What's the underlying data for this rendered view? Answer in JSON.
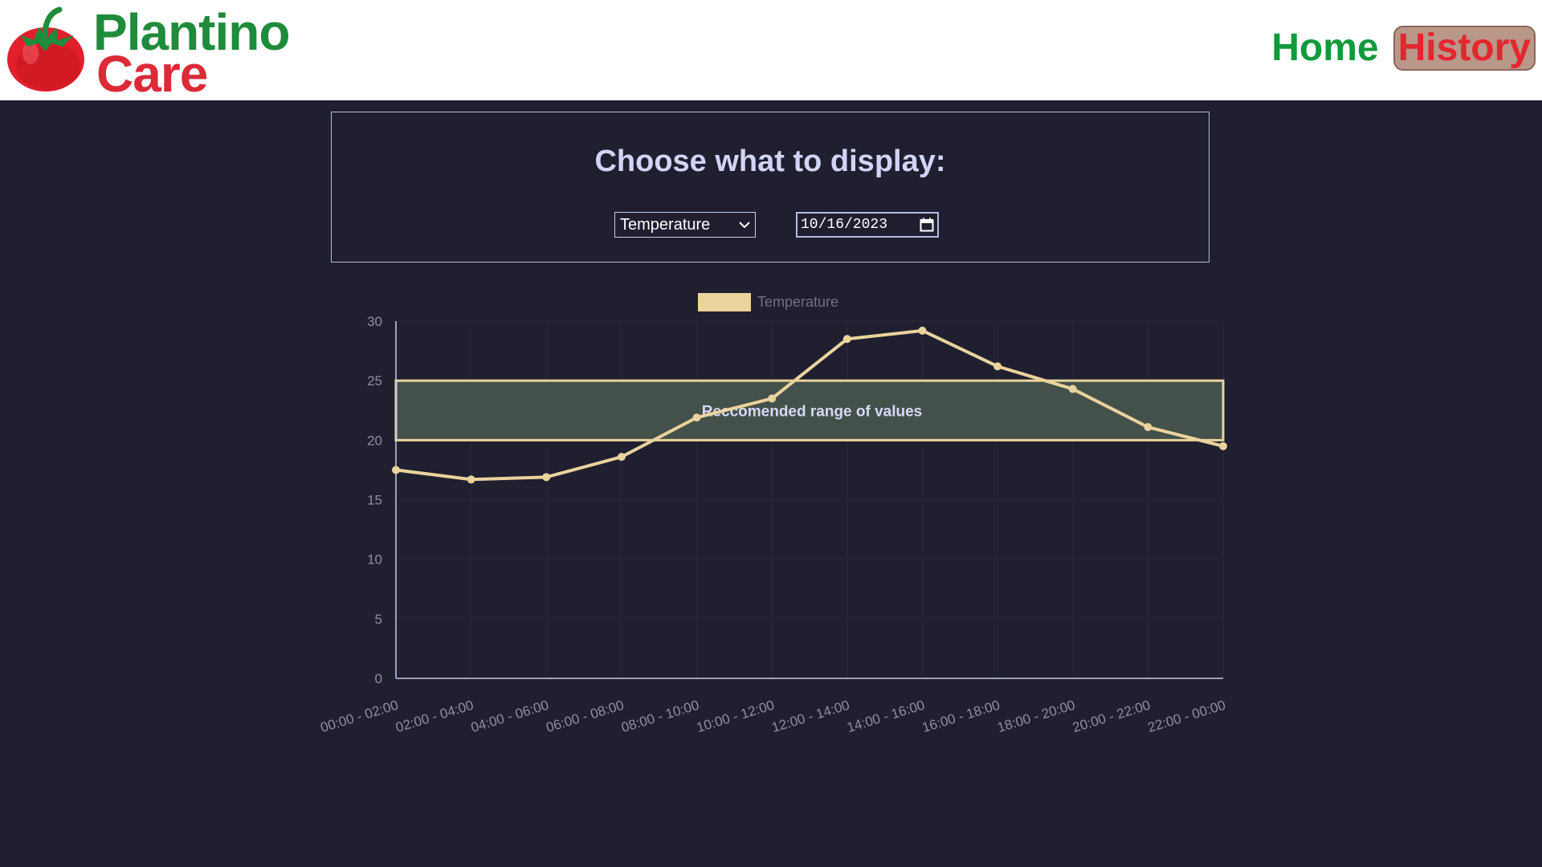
{
  "app": {
    "brand_line1": "Plantino",
    "brand_line2": "Care",
    "brand_colors": {
      "green": "#1f8b3c",
      "red": "#dc2a37"
    }
  },
  "nav": {
    "home_label": "Home",
    "history_label": "History",
    "active": "History"
  },
  "chooser": {
    "title": "Choose what to display:",
    "metric_select": {
      "value": "Temperature"
    },
    "date_input": {
      "value": "10/16/2023"
    }
  },
  "icons": {
    "logo": "tomato-icon",
    "select_arrow": "chevron-down-icon",
    "calendar": "calendar-icon"
  },
  "chart_data": {
    "type": "line",
    "categories": [
      "00:00 - 02:00",
      "02:00 - 04:00",
      "04:00 - 06:00",
      "06:00 - 08:00",
      "08:00 - 10:00",
      "10:00 - 12:00",
      "12:00 - 14:00",
      "14:00 - 16:00",
      "16:00 - 18:00",
      "18:00 - 20:00",
      "20:00 - 22:00",
      "22:00 - 00:00"
    ],
    "series": [
      {
        "name": "Temperature",
        "values": [
          17.5,
          16.7,
          16.9,
          18.6,
          21.9,
          23.5,
          28.5,
          29.2,
          26.2,
          24.3,
          21.1,
          19.5
        ]
      }
    ],
    "ylim": [
      0,
      30
    ],
    "yticks": [
      0,
      5,
      10,
      15,
      20,
      25,
      30
    ],
    "recommended_range": {
      "min": 20,
      "max": 25,
      "label": "Reccomended range of values"
    },
    "legend": "top-center",
    "grid": true,
    "colors": {
      "line": "#ead39c",
      "band_fill": "#43514a",
      "band_border": "#ead39c",
      "band_label": "#d6d9f8",
      "tick": "#8e8f9a",
      "axis": "#c9ccec"
    }
  }
}
